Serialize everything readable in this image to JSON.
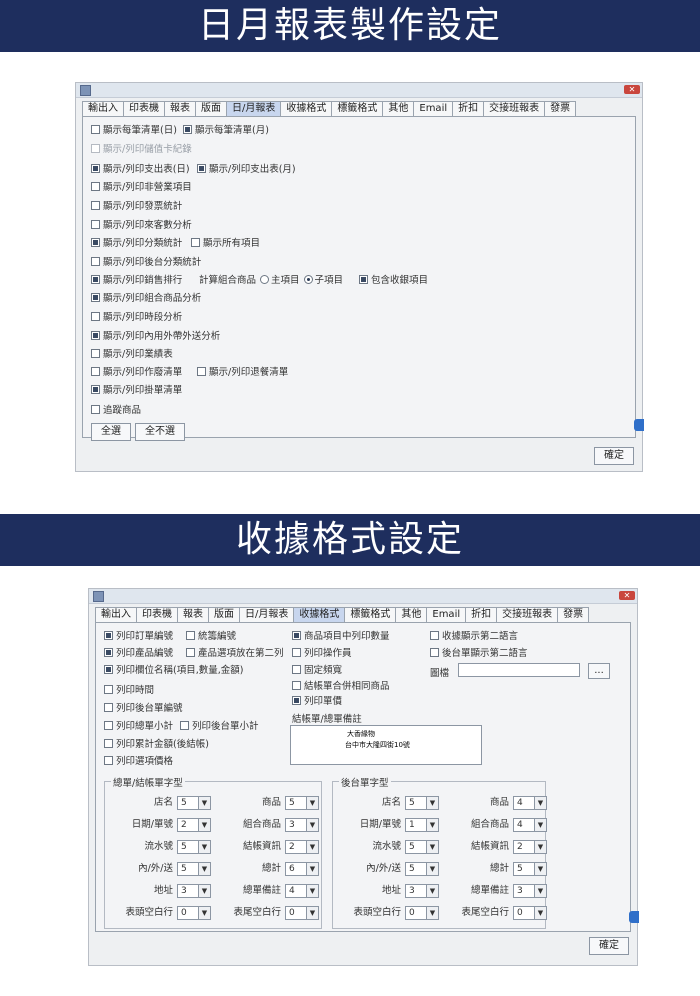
{
  "section1": {
    "banner_title": "日月報表製作設定",
    "window": {
      "tabs": [
        {
          "label": "輸出入",
          "active": false
        },
        {
          "label": "印表機",
          "active": false
        },
        {
          "label": "報表",
          "active": false
        },
        {
          "label": "版面",
          "active": false
        },
        {
          "label": "日/月報表",
          "active": true
        },
        {
          "label": "收據格式",
          "active": false
        },
        {
          "label": "標籤格式",
          "active": false
        },
        {
          "label": "其他",
          "active": false
        },
        {
          "label": "Email",
          "active": false
        },
        {
          "label": "折扣",
          "active": false
        },
        {
          "label": "交接班報表",
          "active": false
        },
        {
          "label": "發票",
          "active": false
        }
      ],
      "checkboxes": [
        {
          "label": "顯示每筆清單(日)",
          "checked": false
        },
        {
          "label": "顯示每筆清單(月)",
          "checked": true
        },
        {
          "label": "顯示/列印儲值卡紀錄",
          "checked": false,
          "disabled": true
        },
        {
          "label": "顯示/列印支出表(日)",
          "checked": true
        },
        {
          "label": "顯示/列印支出表(月)",
          "checked": true
        },
        {
          "label": "顯示/列印非營業項目",
          "checked": false
        },
        {
          "label": "顯示/列印發票統計",
          "checked": false
        },
        {
          "label": "顯示/列印來客數分析",
          "checked": false
        },
        {
          "label": "顯示/列印分類統計",
          "checked": true
        },
        {
          "label": "顯示所有項目",
          "checked": false
        },
        {
          "label": "顯示/列印後台分類統計",
          "checked": false
        },
        {
          "label": "顯示/列印銷售排行",
          "checked": true
        },
        {
          "label": "包含收銀項目",
          "checked": true
        },
        {
          "label": "顯示/列印組合商品分析",
          "checked": true
        },
        {
          "label": "顯示/列印時段分析",
          "checked": false
        },
        {
          "label": "顯示/列印內用外帶外送分析",
          "checked": true
        },
        {
          "label": "顯示/列印業績表",
          "checked": false
        },
        {
          "label": "顯示/列印作廢清單",
          "checked": false
        },
        {
          "label": "顯示/列印退餐清單",
          "checked": false
        },
        {
          "label": "顯示/列印掛單清單",
          "checked": true
        },
        {
          "label": "追蹤商品",
          "checked": false
        }
      ],
      "calc_label": "計算組合商品",
      "radio_main": "主項目",
      "radio_sub": "子項目",
      "select_all": "全選",
      "deselect_all": "全不選",
      "confirm": "確定"
    }
  },
  "section2": {
    "banner_title": "收據格式設定",
    "window": {
      "tabs": [
        {
          "label": "輸出入",
          "active": false
        },
        {
          "label": "印表機",
          "active": false
        },
        {
          "label": "報表",
          "active": false
        },
        {
          "label": "版面",
          "active": false
        },
        {
          "label": "日/月報表",
          "active": false
        },
        {
          "label": "收據格式",
          "active": true
        },
        {
          "label": "標籤格式",
          "active": false
        },
        {
          "label": "其他",
          "active": false
        },
        {
          "label": "Email",
          "active": false
        },
        {
          "label": "折扣",
          "active": false
        },
        {
          "label": "交接班報表",
          "active": false
        },
        {
          "label": "發票",
          "active": false
        }
      ],
      "checkboxes": [
        {
          "label": "列印訂單編號",
          "checked": true
        },
        {
          "label": "統籌編號",
          "checked": false
        },
        {
          "label": "列印產品編號",
          "checked": true
        },
        {
          "label": "產品選項放在第二列",
          "checked": false
        },
        {
          "label": "列印欄位名稱(項目,數量,金額)",
          "checked": true
        },
        {
          "label": "列印時間",
          "checked": false
        },
        {
          "label": "列印後台單編號",
          "checked": false
        },
        {
          "label": "列印總單小計",
          "checked": false
        },
        {
          "label": "列印後台單小計",
          "checked": false
        },
        {
          "label": "列印累計金額(後結帳)",
          "checked": false
        },
        {
          "label": "列印選項價格",
          "checked": false
        },
        {
          "label": "商品項目中列印數量",
          "checked": true
        },
        {
          "label": "列印操作員",
          "checked": false
        },
        {
          "label": "固定頻寬",
          "checked": false
        },
        {
          "label": "結帳單合併相同商品",
          "checked": false
        },
        {
          "label": "列印單價",
          "checked": true
        },
        {
          "label": "收據顯示第二語言",
          "checked": false
        },
        {
          "label": "後台單顯示第二語言",
          "checked": false
        }
      ],
      "logo_label": "圖檔",
      "browse_button": "...",
      "note_label": "結帳單/總單備註",
      "note_line1": "大香緣物",
      "note_line2": "台中市大隆四街10號",
      "group_left_title": "總單/結帳單字型",
      "group_right_title": "後台單字型",
      "left_rows": [
        [
          {
            "label": "店名",
            "value": "5"
          },
          {
            "label": "商品",
            "value": "5"
          }
        ],
        [
          {
            "label": "日期/單號",
            "value": "2"
          },
          {
            "label": "組合商品",
            "value": "3"
          }
        ],
        [
          {
            "label": "流水號",
            "value": "5"
          },
          {
            "label": "結帳資訊",
            "value": "2"
          }
        ],
        [
          {
            "label": "內/外/送",
            "value": "5"
          },
          {
            "label": "總計",
            "value": "6"
          }
        ],
        [
          {
            "label": "地址",
            "value": "3"
          },
          {
            "label": "總單備註",
            "value": "4"
          }
        ],
        [
          {
            "label": "表頭空白行",
            "value": "0"
          },
          {
            "label": "表尾空白行",
            "value": "0"
          }
        ]
      ],
      "right_rows": [
        [
          {
            "label": "店名",
            "value": "5"
          },
          {
            "label": "商品",
            "value": "4"
          }
        ],
        [
          {
            "label": "日期/單號",
            "value": "1"
          },
          {
            "label": "組合商品",
            "value": "4"
          }
        ],
        [
          {
            "label": "流水號",
            "value": "5"
          },
          {
            "label": "結帳資訊",
            "value": "2"
          }
        ],
        [
          {
            "label": "內/外/送",
            "value": "5"
          },
          {
            "label": "總計",
            "value": "5"
          }
        ],
        [
          {
            "label": "地址",
            "value": "3"
          },
          {
            "label": "總單備註",
            "value": "3"
          }
        ],
        [
          {
            "label": "表頭空白行",
            "value": "0"
          },
          {
            "label": "表尾空白行",
            "value": "0"
          }
        ]
      ],
      "confirm": "確定"
    }
  }
}
